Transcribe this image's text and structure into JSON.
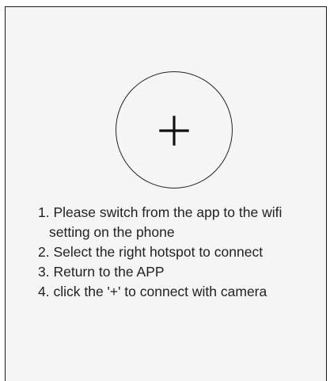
{
  "add_button": {
    "icon": "plus-icon"
  },
  "instructions": [
    {
      "line1": "1. Please switch from the app to the wifi",
      "line2": "setting on the phone"
    },
    {
      "line1": "2. Select the right hotspot to connect"
    },
    {
      "line1": "3. Return to the APP"
    },
    {
      "line1": "4. click the '+' to connect with camera"
    }
  ]
}
